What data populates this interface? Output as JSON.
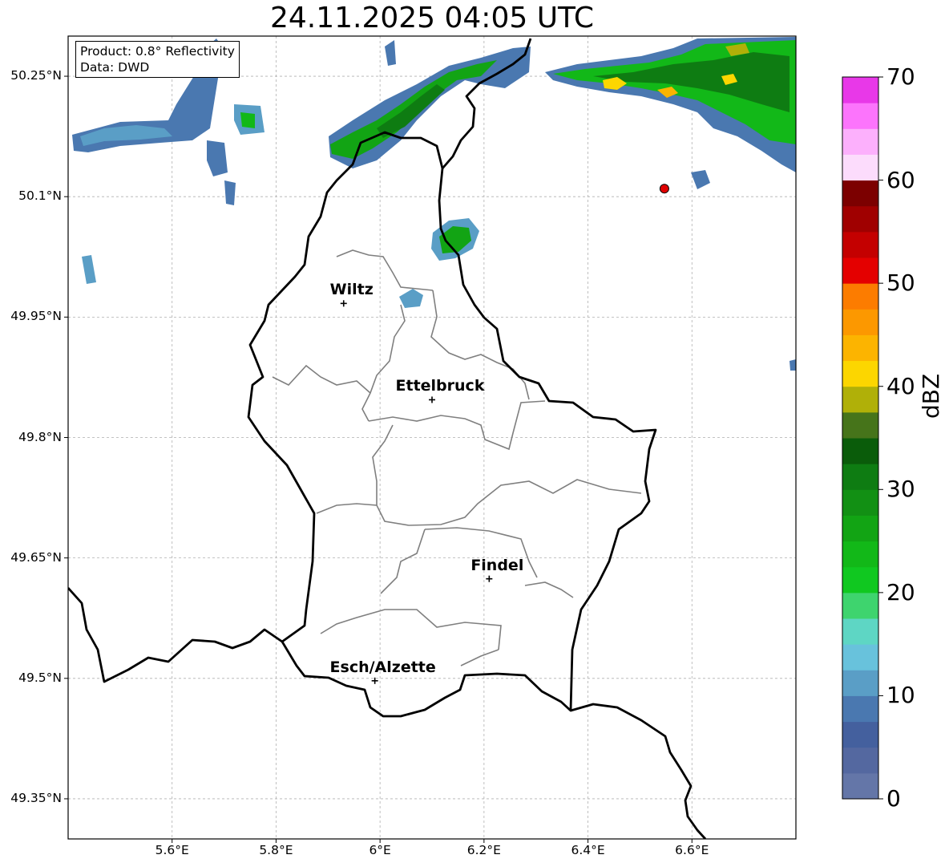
{
  "title": "24.11.2025 04:05 UTC",
  "info": {
    "product": "Product: 0.8° Reflectivity",
    "data_source": "Data: DWD"
  },
  "map": {
    "lon_range": [
      5.4,
      6.8
    ],
    "lat_range": [
      49.3,
      50.3
    ],
    "lat_ticks": [
      {
        "value": 50.25,
        "label": "50.25°N"
      },
      {
        "value": 50.1,
        "label": "50.1°N"
      },
      {
        "value": 49.95,
        "label": "49.95°N"
      },
      {
        "value": 49.8,
        "label": "49.8°N"
      },
      {
        "value": 49.65,
        "label": "49.65°N"
      },
      {
        "value": 49.5,
        "label": "49.5°N"
      },
      {
        "value": 49.35,
        "label": "49.35°N"
      }
    ],
    "lon_ticks": [
      {
        "value": 5.6,
        "label": "5.6°E"
      },
      {
        "value": 5.8,
        "label": "5.8°E"
      },
      {
        "value": 6.0,
        "label": "6°E"
      },
      {
        "value": 6.2,
        "label": "6.2°E"
      },
      {
        "value": 6.4,
        "label": "6.4°E"
      },
      {
        "value": 6.6,
        "label": "6.6°E"
      }
    ],
    "cities": [
      {
        "name": "Wiltz",
        "lon": 5.93,
        "lat": 49.967
      },
      {
        "name": "Ettelbruck",
        "lon": 6.1,
        "lat": 49.847
      },
      {
        "name": "Findel",
        "lon": 6.21,
        "lat": 49.624
      },
      {
        "name": "Esch/Alzette",
        "lon": 5.99,
        "lat": 49.497
      }
    ],
    "radar_marker": {
      "lon": 6.547,
      "lat": 50.11,
      "color": "#e00000"
    }
  },
  "colorbar": {
    "label": "dBZ",
    "min": 0,
    "max": 70,
    "step": 2.5,
    "ticks": [
      0,
      10,
      20,
      30,
      40,
      50,
      60,
      70
    ],
    "colors": [
      "#6476a8",
      "#5468a0",
      "#44609e",
      "#4a78b0",
      "#5a9ec6",
      "#68c2dc",
      "#5ed6c4",
      "#3ed46e",
      "#10c820",
      "#12b818",
      "#12a414",
      "#129014",
      "#0e7c12",
      "#0a5c0a",
      "#46741a",
      "#b0b008",
      "#fcd600",
      "#fcb400",
      "#fc9800",
      "#fc7c00",
      "#e40000",
      "#c40000",
      "#a00000",
      "#7c0000",
      "#fcdcfc",
      "#fcb0fc",
      "#fc74fc",
      "#e838e8"
    ]
  }
}
